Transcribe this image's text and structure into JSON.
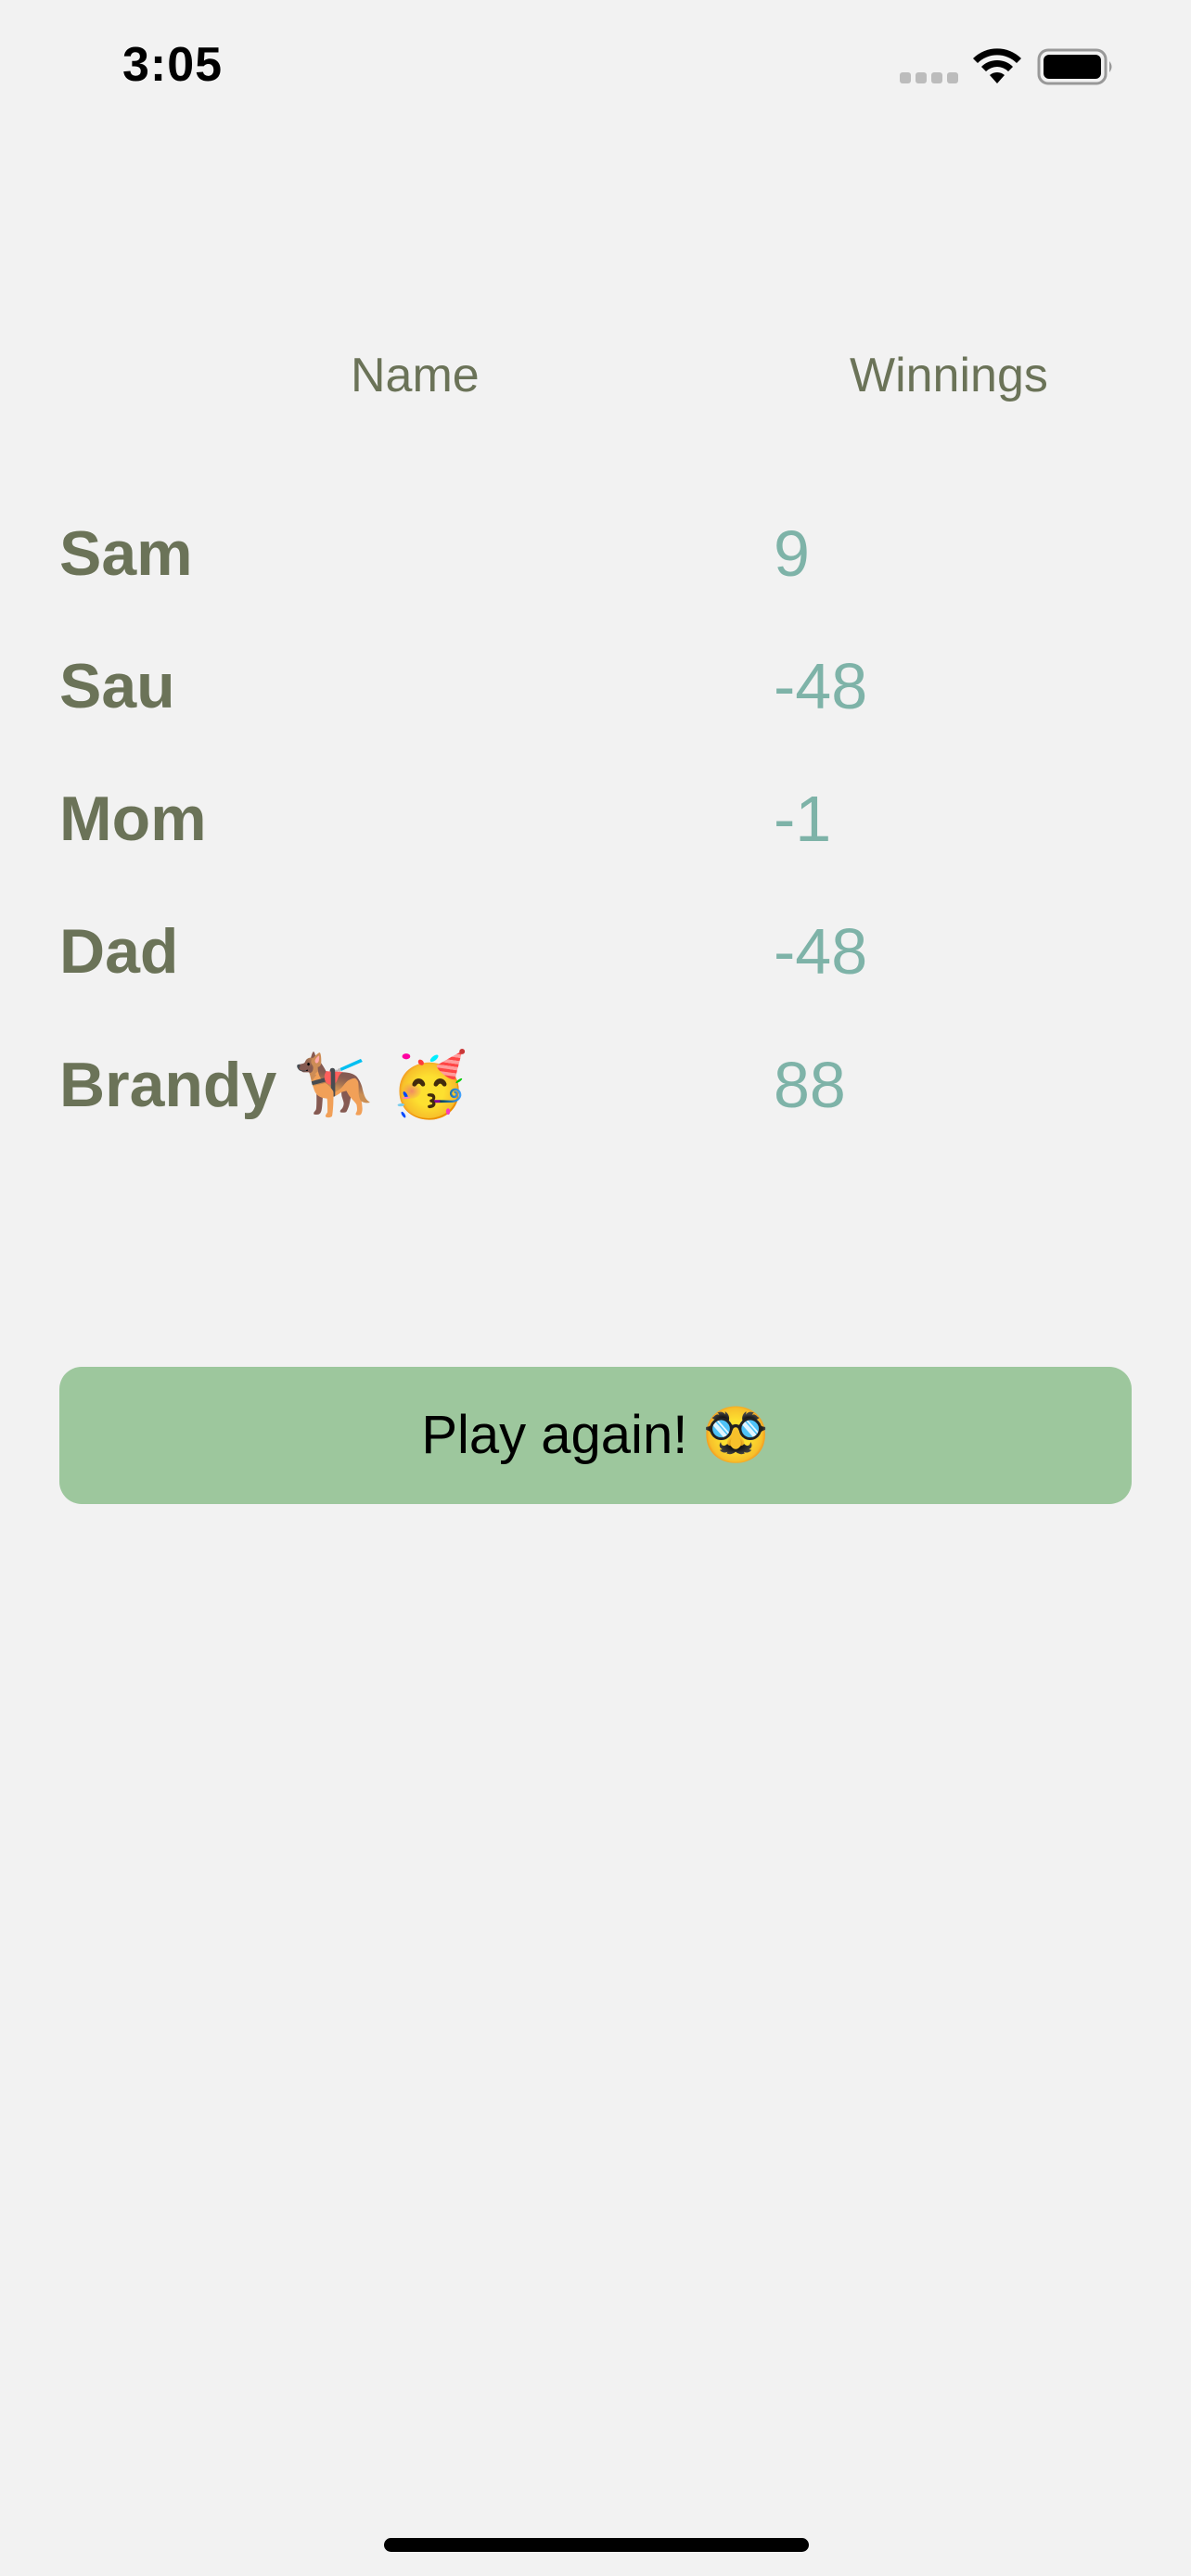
{
  "status_bar": {
    "time": "3:05",
    "icons": [
      "signal-icon",
      "wifi-icon",
      "battery-icon"
    ]
  },
  "table": {
    "headers": {
      "name": "Name",
      "winnings": "Winnings"
    },
    "rows": [
      {
        "name": "Sam",
        "winnings": "9"
      },
      {
        "name": "Sau",
        "winnings": "-48"
      },
      {
        "name": "Mom",
        "winnings": "-1"
      },
      {
        "name": "Dad",
        "winnings": "-48"
      },
      {
        "name": "Brandy 🐕‍🦺 🥳",
        "winnings": "88"
      }
    ]
  },
  "play_button": {
    "label": "Play again! 🥸"
  },
  "colors": {
    "background": "#f2f2f2",
    "name_text": "#6b7358",
    "winnings_text": "#7eb3a8",
    "button_background": "#9dc79d"
  }
}
